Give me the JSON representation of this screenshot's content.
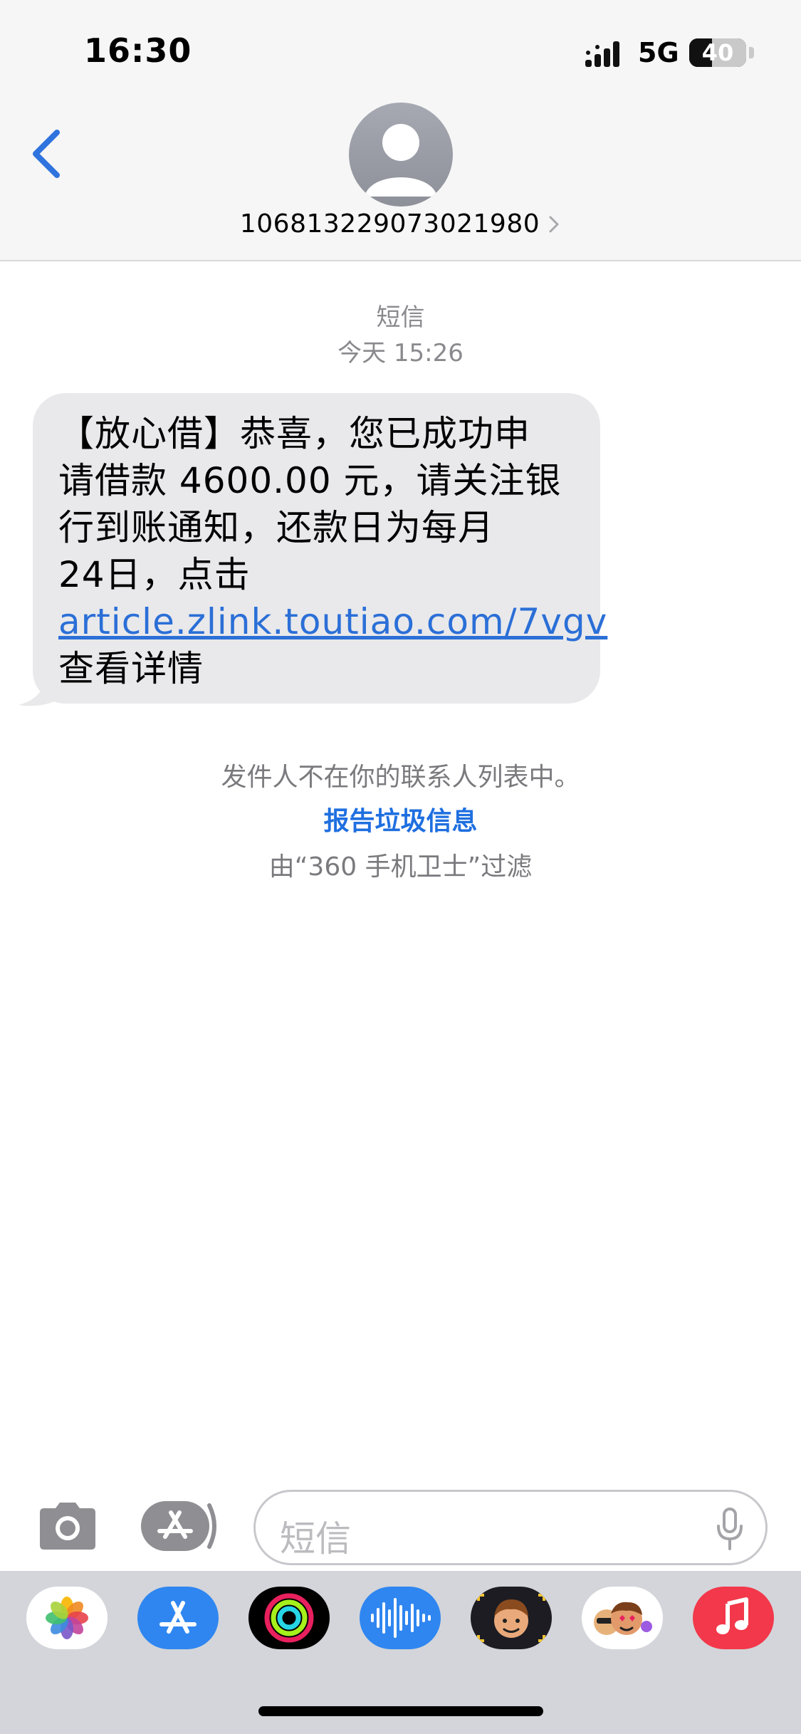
{
  "status_bar": {
    "time": "16:30",
    "network": "5G",
    "battery_level": "40",
    "battery_fraction": 0.4,
    "signal_icon": "signal-bars-icon"
  },
  "header": {
    "back_icon": "chevron-left-icon",
    "avatar_icon": "person-avatar-icon",
    "contact_number": "106813229073021980",
    "detail_icon": "chevron-right-icon"
  },
  "conversation": {
    "service_label": "短信",
    "timestamp": "今天 15:26",
    "message": {
      "line1": "【放心借】恭喜，您已成功申",
      "line2": "请借款 4600.00 元，请关注银",
      "line3": "行到账通知，还款日为每月",
      "line4": "24日，点击",
      "link": "article.zlink.toutiao.com/7vgv",
      "line6": "查看详情"
    },
    "not_in_contacts": "发件人不在你的联系人列表中。",
    "report_junk": "报告垃圾信息",
    "filtered_by": "由“360 手机卫士”过滤"
  },
  "input_bar": {
    "camera_icon": "camera-icon",
    "apps_icon": "app-store-icon",
    "placeholder": "短信",
    "mic_icon": "microphone-icon"
  },
  "app_drawer": {
    "apps": [
      "photos-icon",
      "app-store-icon",
      "activity-rings-icon",
      "audio-message-icon",
      "memoji-icon",
      "memoji-stickers-icon",
      "music-icon"
    ]
  },
  "colors": {
    "accent_blue": "#2b6fd7",
    "bubble_gray": "#e9e9eb",
    "header_bg": "#f6f6f6",
    "drawer_bg": "#d3d5da"
  }
}
